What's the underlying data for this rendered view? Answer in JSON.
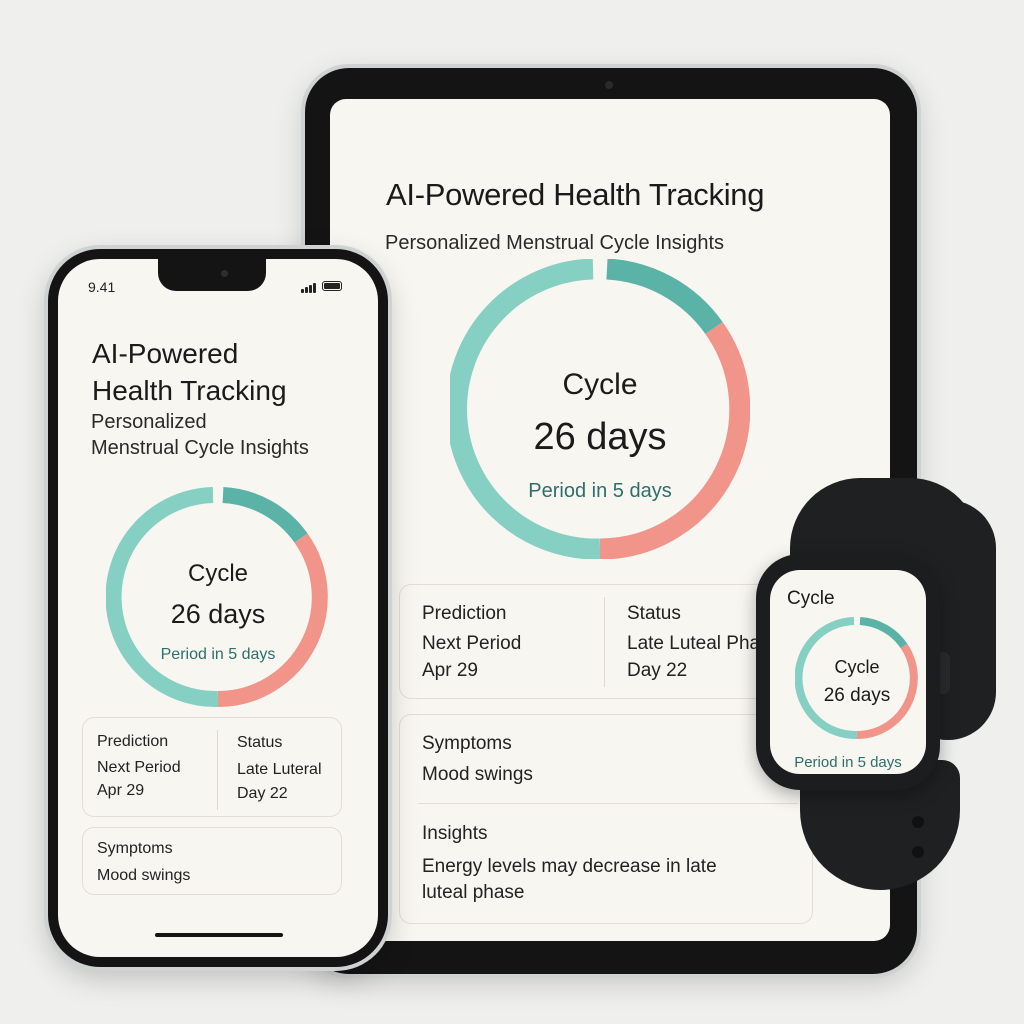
{
  "colors": {
    "teal_light": "#86cfc3",
    "teal_dark": "#5bb3a8",
    "coral": "#f1948a",
    "accent_text": "#2e6e6b"
  },
  "tablet": {
    "title": "AI-Powered Health Tracking",
    "subtitle": "Personalized Menstrual Cycle Insights",
    "cycle_label": "Cycle",
    "cycle_days": "26 days",
    "period_text": "Period in 5 days",
    "prediction": {
      "heading": "Prediction",
      "line1": "Next Period",
      "line2": "Apr 29"
    },
    "status": {
      "heading": "Status",
      "line1": "Late Luteal Phat",
      "line2": "Day 22"
    },
    "symptoms": {
      "heading": "Symptoms",
      "value": "Mood swings"
    },
    "insights": {
      "heading": "Insights",
      "line1": "Energy levels may decrease in late",
      "line2": "luteal phase"
    }
  },
  "phone": {
    "time": "9.41",
    "title_line1": "AI-Powered",
    "title_line2": "Health Tracking",
    "subtitle_line1": "Personalized",
    "subtitle_line2": "Menstrual Cycle Insights",
    "cycle_label": "Cycle",
    "cycle_days": "26 days",
    "period_text": "Period in 5 days",
    "prediction": {
      "heading": "Prediction",
      "line1": "Next Period",
      "line2": "Apr 29"
    },
    "status": {
      "heading": "Status",
      "line1": "Late Luteral",
      "line2": "Day 22"
    },
    "symptoms": {
      "heading": "Symptoms",
      "value": "Mood swings"
    }
  },
  "watch": {
    "title": "Cycle",
    "cycle_label": "Cycle",
    "cycle_days": "26 days",
    "period_text": "Period in 5 days"
  },
  "cycle_progress": {
    "days_total": 26,
    "segments": [
      "teal_light",
      "teal_dark",
      "coral"
    ]
  }
}
